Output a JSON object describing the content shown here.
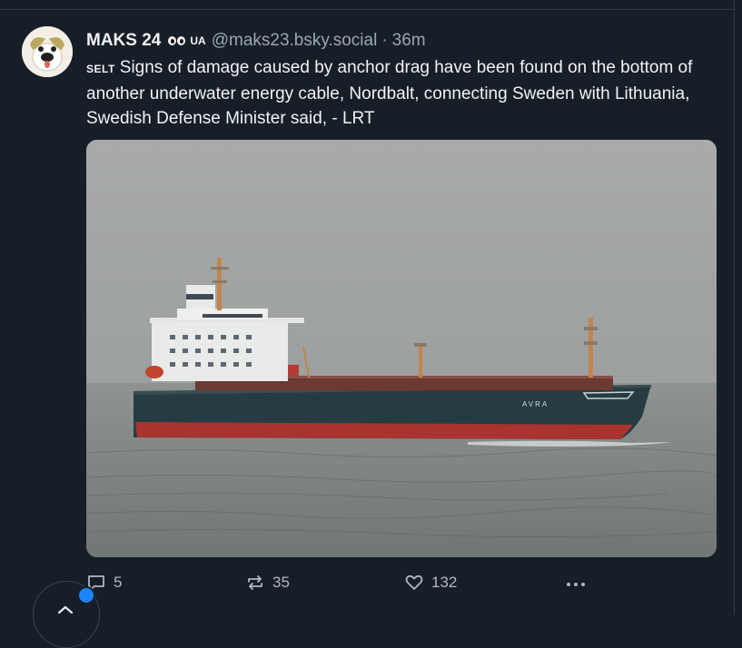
{
  "post": {
    "author_name": "MAKS 24",
    "author_badge": "UA",
    "handle": "@maks23.bsky.social",
    "separator": "·",
    "time": "36m",
    "label": "SELT",
    "text": "Signs of damage caused by anchor drag have been found on the bottom of another underwater energy cable, Nordbalt, connecting Sweden with Lithuania, Swedish Defense Minister said, - LRT"
  },
  "image": {
    "ship_name": "AVRA"
  },
  "actions": {
    "replies": "5",
    "reposts": "35",
    "likes": "132"
  },
  "icons": [
    "avatar-icon",
    "eyes-emoji-icon",
    "reply-icon",
    "repost-icon",
    "like-icon",
    "more-icon",
    "scroll-top-icon"
  ],
  "colors": {
    "background": "#161e27",
    "text": "#f1f3f5",
    "muted": "#9aa7b4",
    "accent": "#1d83ff",
    "ship_hull": "#253d42",
    "ship_bottom": "#a8332f"
  }
}
